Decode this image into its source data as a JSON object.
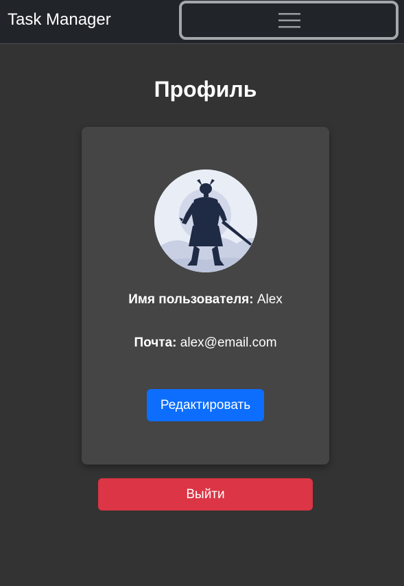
{
  "navbar": {
    "brand": "Task Manager",
    "toggler_icon": "hamburger-menu-icon"
  },
  "profile": {
    "title": "Профиль",
    "avatar_icon": "samurai-silhouette-avatar",
    "username_label": "Имя пользователя:",
    "username_value": "Alex",
    "email_label": "Почта:",
    "email_value": "alex@email.com",
    "edit_label": "Редактировать"
  },
  "logout_label": "Выйти",
  "colors": {
    "background": "#333333",
    "navbar": "#212529",
    "card": "#454545",
    "primary": "#0d6efd",
    "danger": "#dc3545",
    "avatar_bg": "#e9edf6",
    "silhouette": "#1f2a44"
  }
}
